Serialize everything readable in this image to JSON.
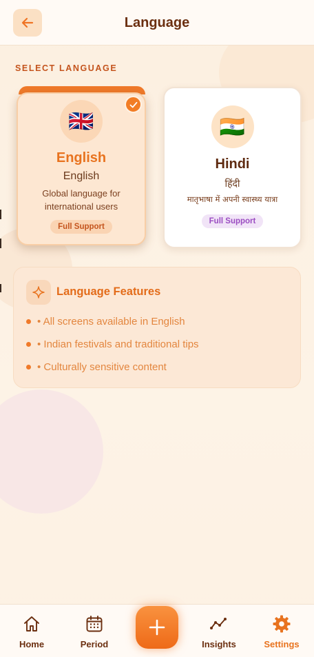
{
  "header": {
    "title": "Language"
  },
  "section_label": "SELECT LANGUAGE",
  "languages": [
    {
      "name": "English",
      "native": "English",
      "description": "Global language for international users",
      "support": "Full Support",
      "flag": "🇬🇧",
      "selected": true
    },
    {
      "name": "Hindi",
      "native": "हिंदी",
      "description": "मातृभाषा में अपनी स्वास्थ्य यात्रा",
      "support": "Full Support",
      "flag": "🇮🇳",
      "selected": false
    }
  ],
  "features": {
    "title": "Language Features",
    "items": [
      "• All screens available in English",
      "• Indian festivals and traditional tips",
      "• Culturally sensitive content"
    ]
  },
  "nav": {
    "home": "Home",
    "period": "Period",
    "insights": "Insights",
    "settings": "Settings",
    "active": "Settings"
  },
  "icons": {
    "back": "arrow-left-icon",
    "check": "check-icon",
    "sparkle": "sparkle-icon",
    "home": "home-icon",
    "period": "calendar-icon",
    "add": "plus-icon",
    "insights": "trend-line-icon",
    "settings": "gear-icon"
  },
  "colors": {
    "accent": "#f07a2a",
    "title": "#6b2f10",
    "hindi_pill": "#9b4dc2"
  }
}
